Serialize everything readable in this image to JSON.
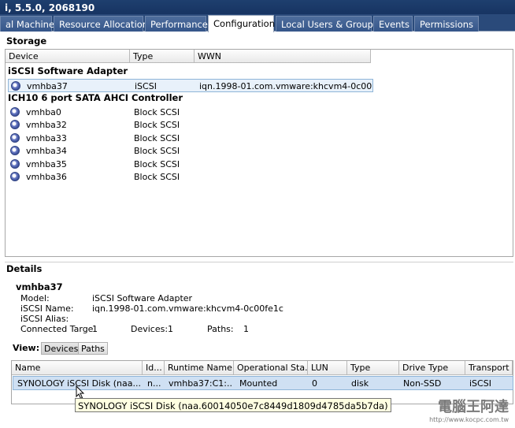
{
  "window": {
    "title": "i, 5.5.0, 2068190"
  },
  "tabs": [
    {
      "label": "al Machines"
    },
    {
      "label": "Resource Allocation"
    },
    {
      "label": "Performance"
    },
    {
      "label": "Configuration"
    },
    {
      "label": "Local Users & Groups"
    },
    {
      "label": "Events"
    },
    {
      "label": "Permissions"
    }
  ],
  "storage": {
    "title": "Storage",
    "columns": [
      "Device",
      "Type",
      "WWN"
    ],
    "groups": [
      {
        "label": "iSCSI Software Adapter",
        "rows": [
          {
            "device": "vmhba37",
            "type": "iSCSI",
            "wwn": "iqn.1998-01.com.vmware:khcvm4-0c00..."
          }
        ]
      },
      {
        "label": "ICH10 6 port SATA AHCI Controller",
        "rows": [
          {
            "device": "vmhba0",
            "type": "Block SCSI",
            "wwn": ""
          },
          {
            "device": "vmhba32",
            "type": "Block SCSI",
            "wwn": ""
          },
          {
            "device": "vmhba33",
            "type": "Block SCSI",
            "wwn": ""
          },
          {
            "device": "vmhba34",
            "type": "Block SCSI",
            "wwn": ""
          },
          {
            "device": "vmhba35",
            "type": "Block SCSI",
            "wwn": ""
          },
          {
            "device": "vmhba36",
            "type": "Block SCSI",
            "wwn": ""
          }
        ]
      }
    ]
  },
  "details": {
    "title": "Details",
    "adapter": "vmhba37",
    "model_label": "Model:",
    "model_value": "iSCSI Software Adapter",
    "iscsi_name_label": "iSCSI Name:",
    "iscsi_name_value": "iqn.1998-01.com.vmware:khcvm4-0c00fe1c",
    "iscsi_alias_label": "iSCSI Alias:",
    "connected_label": "Connected Targe",
    "connected_value": "1",
    "devices_label": "Devices:",
    "devices_value": "1",
    "paths_label": "Paths:",
    "paths_value": "1"
  },
  "view": {
    "label": "View:",
    "buttons": [
      "Devices",
      "Paths"
    ],
    "active": "Devices"
  },
  "devices_table": {
    "columns": [
      "Name",
      "Id...",
      "Runtime Name",
      "Operational Sta...",
      "LUN",
      "Type",
      "Drive Type",
      "Transport"
    ],
    "rows": [
      {
        "name": "SYNOLOGY iSCSI Disk (naa....",
        "id": "n...",
        "runtime": "vmhba37:C1:...",
        "state": "Mounted",
        "lun": "0",
        "type": "disk",
        "drive": "Non-SSD",
        "transport": "iSCSI"
      }
    ]
  },
  "tooltip": "SYNOLOGY iSCSI Disk (naa.60014050e7c8449d1809d4785da5b7da)",
  "watermark": {
    "brand": "電腦王阿達",
    "url": "http://www.kocpc.com.tw"
  }
}
